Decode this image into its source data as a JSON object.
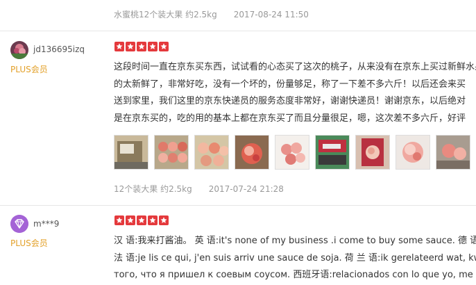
{
  "reviews": [
    {
      "product_spec": "水蜜桃12个装大果 约2.5kg",
      "date": "2017-08-24 11:50"
    },
    {
      "username": "jd136695izq",
      "membership": "PLUS会员",
      "rating": 5,
      "content_lines": [
        "这段时间一直在京东买东西，试试看的心态买了这次的桃子，从来没有在京东上买过新鲜水果",
        "的太新鲜了，非常好吃，没有一个坏的，份量够足，称了一下差不多六斤！以后还会来买",
        "送到家里，我们这里的京东快递员的服务态度非常好，谢谢快递员！谢谢京东，以后绝对",
        "是在京东买的，吃的用的基本上都在京东买了而且分量很足，嗯，这次差不多六斤，好评"
      ],
      "photos": [
        "peach-box-photo",
        "peach-tray-photo",
        "peach-tray-photo",
        "peach-closeup-photo",
        "peach-bag-photo",
        "peach-scale-photo",
        "peach-hand-photo",
        "peach-single-photo",
        "peach-table-photo"
      ],
      "product_spec": "12个装大果 约2.5kg",
      "date": "2017-07-24 21:28"
    },
    {
      "username": "m***9",
      "membership": "PLUS会员",
      "rating": 5,
      "content_lines": [
        "汉 语:我来打酱油。 英 语:it's none of my business .i come to buy some sauce. 德 语:",
        "法 语:je lis ce qui, j'en suis arriv une sauce de soja. 荷 兰 语:ik gerelateerd wat, kwam",
        "того, что я пришел к соевым соусом. 西班牙语:relacionados con lo que yo, me vino"
      ]
    }
  ],
  "colors": {
    "star": "#e4393c",
    "plus": "#e3a12a",
    "meta": "#999999",
    "divider": "#e6e6e6"
  }
}
